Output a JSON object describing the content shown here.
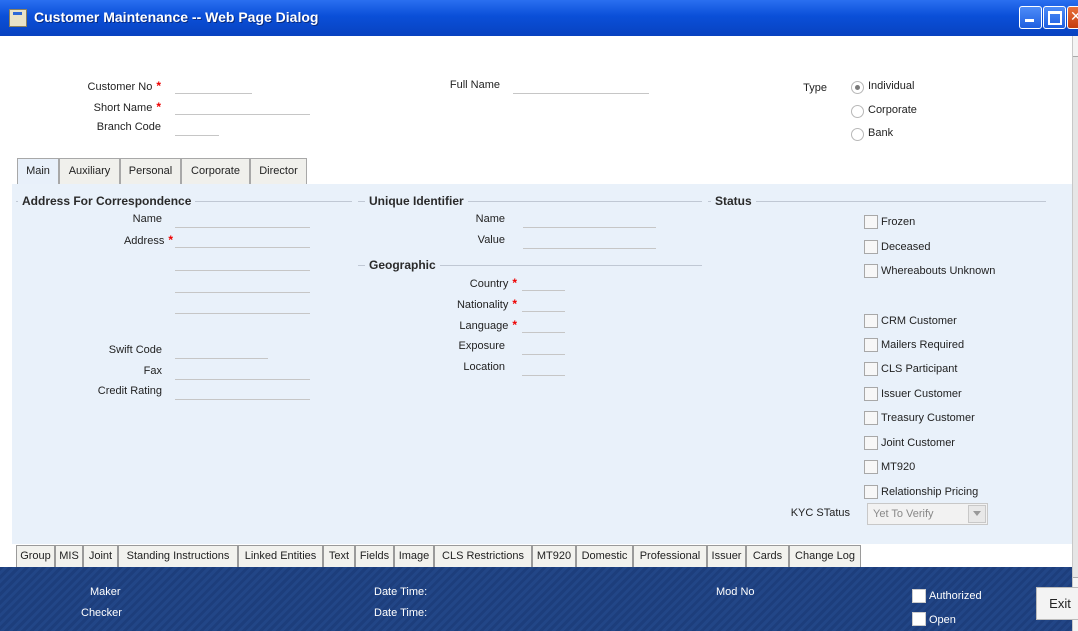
{
  "window": {
    "title": "Customer Maintenance -- Web Page Dialog"
  },
  "header": {
    "customer_no": {
      "label": "Customer No",
      "value": ""
    },
    "short_name": {
      "label": "Short Name",
      "value": ""
    },
    "branch_code": {
      "label": "Branch Code",
      "value": ""
    },
    "full_name": {
      "label": "Full Name",
      "value": ""
    },
    "type": {
      "label": "Type",
      "options": [
        "Individual",
        "Corporate",
        "Bank"
      ],
      "selected": "Individual"
    },
    "required_mark": "*"
  },
  "tabs": [
    "Main",
    "Auxiliary",
    "Personal",
    "Corporate",
    "Director"
  ],
  "main": {
    "address_section": {
      "title": "Address For Correspondence",
      "name_label": "Name",
      "address_label": "Address",
      "swift_label": "Swift Code",
      "fax_label": "Fax",
      "credit_label": "Credit Rating"
    },
    "unique_section": {
      "title": "Unique Identifier",
      "name_label": "Name",
      "value_label": "Value"
    },
    "geo_section": {
      "title": "Geographic",
      "country_label": "Country",
      "nationality_label": "Nationality",
      "language_label": "Language",
      "exposure_label": "Exposure",
      "location_label": "Location"
    },
    "status_section": {
      "title": "Status",
      "checkboxes": [
        "Frozen",
        "Deceased",
        "Whereabouts Unknown",
        "CRM Customer",
        "Mailers Required",
        "CLS Participant",
        "Issuer Customer",
        "Treasury Customer",
        "Joint Customer",
        "MT920",
        "Relationship Pricing"
      ],
      "kyc_label": "KYC STatus",
      "kyc_value": "Yet To Verify"
    }
  },
  "bottom_tabs": [
    "Group",
    "MIS",
    "Joint",
    "Standing Instructions",
    "Linked Entities",
    "Text",
    "Fields",
    "Image",
    "CLS Restrictions",
    "MT920",
    "Domestic",
    "Professional",
    "Issuer",
    "Cards",
    "Change Log"
  ],
  "footer": {
    "maker": "Maker",
    "checker": "Checker",
    "date_time_1": "Date Time:",
    "date_time_2": "Date Time:",
    "mod_no": "Mod No",
    "authorized": "Authorized",
    "open": "Open",
    "exit": "Exit"
  }
}
